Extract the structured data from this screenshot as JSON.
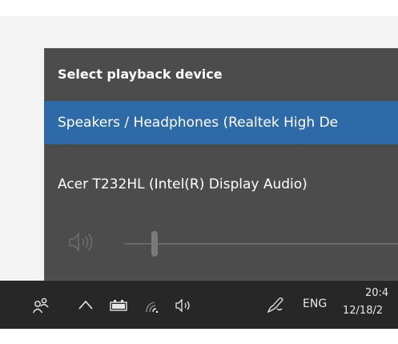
{
  "flyout": {
    "title": "Select playback device",
    "devices": [
      {
        "label": "Speakers / Headphones (Realtek High De",
        "selected": true
      },
      {
        "label": "Acer T232HL (Intel(R) Display Audio)",
        "selected": false
      }
    ],
    "volume": {
      "icon": "speaker-icon",
      "level_fraction": 0.1
    }
  },
  "taskbar": {
    "icons": [
      "people-icon",
      "chevron-up-icon",
      "battery-icon",
      "wifi-icon",
      "volume-icon",
      "pen-icon"
    ],
    "language": "ENG",
    "time": "20:4",
    "date": "12/18/2"
  },
  "colors": {
    "accent": "#2e6aa8",
    "flyout_bg": "#4c4c4c",
    "taskbar_bg": "#272727"
  }
}
